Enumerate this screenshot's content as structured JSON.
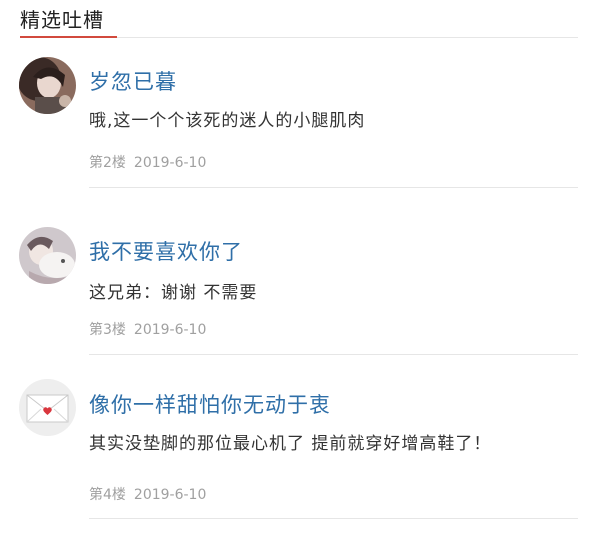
{
  "section": {
    "title": "精选吐槽"
  },
  "comments": [
    {
      "user": "岁忽已暮",
      "text": "哦,这一个个该死的迷人的小腿肌肉",
      "floor": "第2楼",
      "date": "2019-6-10"
    },
    {
      "user": "我不要喜欢你了",
      "text": "这兄弟：谢谢 不需要",
      "floor": "第3楼",
      "date": "2019-6-10"
    },
    {
      "user": "像你一样甜怕你无动于衷",
      "text": "其实没垫脚的那位最心机了 提前就穿好增高鞋了！",
      "floor": "第4楼",
      "date": "2019-6-10"
    }
  ],
  "colors": {
    "accent": "#d24a3d",
    "username": "#2f6fa8",
    "meta": "#a0a0a0"
  },
  "icons": [
    "avatar-woman-portrait",
    "avatar-woman-with-cat",
    "avatar-love-letter-envelope"
  ]
}
